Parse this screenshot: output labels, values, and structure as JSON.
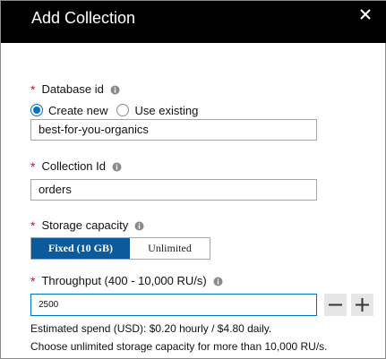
{
  "header": {
    "title": "Add Collection",
    "close_icon": "close-icon"
  },
  "colors": {
    "header_bg": "#000000",
    "required": "#e00b1c",
    "accent": "#0072c6",
    "segment_active": "#0a5a9c",
    "stepper_bg": "#e6e6e6"
  },
  "form": {
    "database": {
      "required_mark": "*",
      "label": "Database id",
      "info_icon": "info-icon",
      "options": [
        "Create new",
        "Use existing"
      ],
      "selected": "Create new",
      "value": "best-for-you-organics"
    },
    "collection": {
      "required_mark": "*",
      "label": "Collection Id",
      "info_icon": "info-icon",
      "value": "orders"
    },
    "storage": {
      "required_mark": "*",
      "label": "Storage capacity",
      "info_icon": "info-icon",
      "options": [
        "Fixed (10 GB)",
        "Unlimited"
      ],
      "selected": "Fixed (10 GB)"
    },
    "throughput": {
      "required_mark": "*",
      "label": "Throughput (400 - 10,000 RU/s)",
      "info_icon": "info-icon",
      "value": "2500",
      "decrement_icon": "minus-icon",
      "increment_icon": "plus-icon"
    },
    "estimated_spend": "Estimated spend (USD): $0.20 hourly / $4.80 daily.",
    "unlimited_note": "Choose unlimited storage capacity for more than 10,000 RU/s."
  }
}
